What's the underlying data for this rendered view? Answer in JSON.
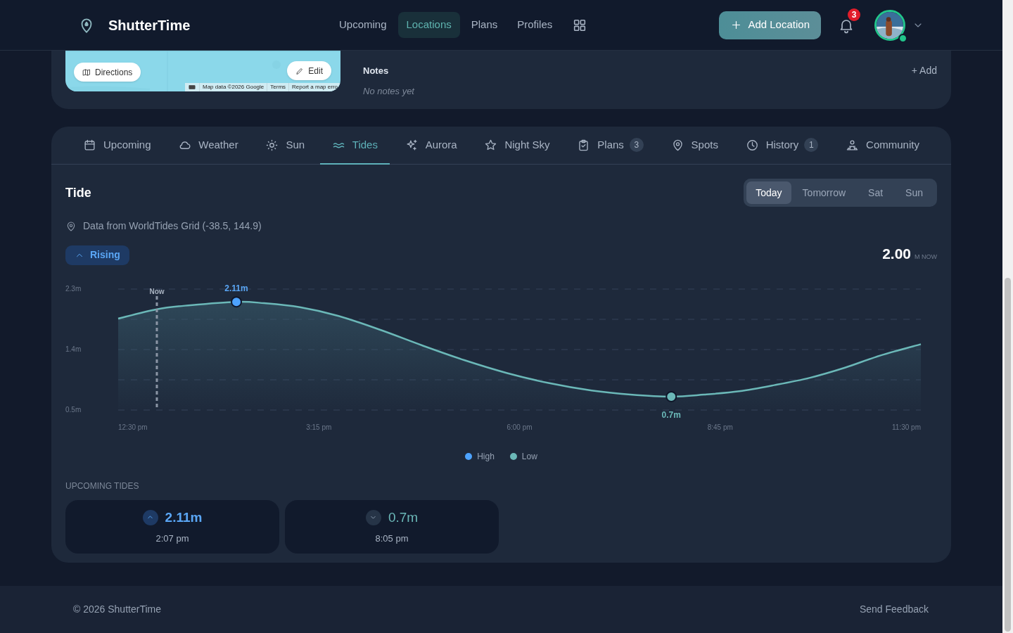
{
  "header": {
    "logo": "ShutterTime",
    "nav": [
      {
        "label": "Upcoming",
        "selected": false
      },
      {
        "label": "Locations",
        "selected": true
      },
      {
        "label": "Plans",
        "selected": false
      },
      {
        "label": "Profiles",
        "selected": false
      }
    ],
    "add_button": "Add Location",
    "notification_count": "3"
  },
  "location_card": {
    "map": {
      "kind": "picture",
      "buttons": [
        "Directions",
        "Edit"
      ],
      "attribution": [
        "Map data ©2026 Google",
        "Terms",
        "Report a map erro"
      ]
    },
    "notes": {
      "title": "Notes",
      "add": "+ Add",
      "empty": "No notes yet"
    }
  },
  "tabs": [
    {
      "label": "Upcoming",
      "selected": false
    },
    {
      "label": "Weather",
      "selected": false
    },
    {
      "label": "Sun",
      "selected": false
    },
    {
      "label": "Tides",
      "selected": true
    },
    {
      "label": "Aurora",
      "selected": false
    },
    {
      "label": "Night Sky",
      "selected": false
    },
    {
      "label": "Plans",
      "selected": false,
      "badge": "3"
    },
    {
      "label": "Spots",
      "selected": false
    },
    {
      "label": "History",
      "selected": false,
      "badge": "1"
    },
    {
      "label": "Community",
      "selected": false
    }
  ],
  "tide": {
    "title": "Tide",
    "days": [
      {
        "label": "Today",
        "selected": true
      },
      {
        "label": "Tomorrow",
        "selected": false
      },
      {
        "label": "Sat",
        "selected": false
      },
      {
        "label": "Sun",
        "selected": false
      }
    ],
    "source": "Data from WorldTides Grid (-38.5, 144.9)",
    "trend": "Rising",
    "current_value": "2.00",
    "current_unit": "M NOW",
    "chart_data": {
      "type": "area",
      "x": [
        12.5,
        13.03,
        13.49,
        14.12,
        14.5,
        14.99,
        15.52,
        16.1,
        16.67,
        17.25,
        17.83,
        18.41,
        18.99,
        19.52,
        20.08,
        20.53,
        21.01,
        21.49,
        21.98,
        22.46,
        22.94,
        23.5
      ],
      "series": [
        {
          "color": "#6bb8b8",
          "values": [
            1.86,
            2.0,
            2.06,
            2.11,
            2.09,
            2.03,
            1.9,
            1.69,
            1.46,
            1.24,
            1.05,
            0.9,
            0.79,
            0.73,
            0.7,
            0.73,
            0.78,
            0.87,
            0.98,
            1.13,
            1.31,
            1.48
          ]
        }
      ],
      "xlim": [
        12.5,
        23.5
      ],
      "ylim": [
        0.5,
        2.3
      ],
      "xticks": [
        {
          "value": 12.5,
          "label": "12:30 pm"
        },
        {
          "value": 15.25,
          "label": "3:15 pm"
        },
        {
          "value": 18,
          "label": "6:00 pm"
        },
        {
          "value": 20.75,
          "label": "8:45 pm"
        },
        {
          "value": 23.5,
          "label": "11:30 pm"
        }
      ],
      "yticks": [
        {
          "value": 2.3,
          "label": "2.3m"
        },
        {
          "value": 1.4,
          "label": "1.4m"
        },
        {
          "value": 0.5,
          "label": "0.5m"
        }
      ],
      "ref_lines": [
        {
          "axis": "x",
          "value": 13.03,
          "label": "Now"
        }
      ],
      "annotations": [
        {
          "x": 14.12,
          "y": 2.11,
          "text": "2.11m"
        },
        {
          "x": 20.08,
          "y": 0.7,
          "text": "0.7m"
        }
      ]
    },
    "legend": [
      {
        "label": "High",
        "color": "#4da3ff"
      },
      {
        "label": "Low",
        "color": "#6bb8b8"
      }
    ],
    "upcoming_title": "UPCOMING TIDES",
    "upcoming": [
      {
        "kind": "high",
        "height": "2.11m",
        "time": "2:07 pm"
      },
      {
        "kind": "low",
        "height": "0.7m",
        "time": "8:05 pm"
      }
    ]
  },
  "footer": {
    "copyright": "© 2026 ShutterTime",
    "feedback": "Send Feedback"
  }
}
